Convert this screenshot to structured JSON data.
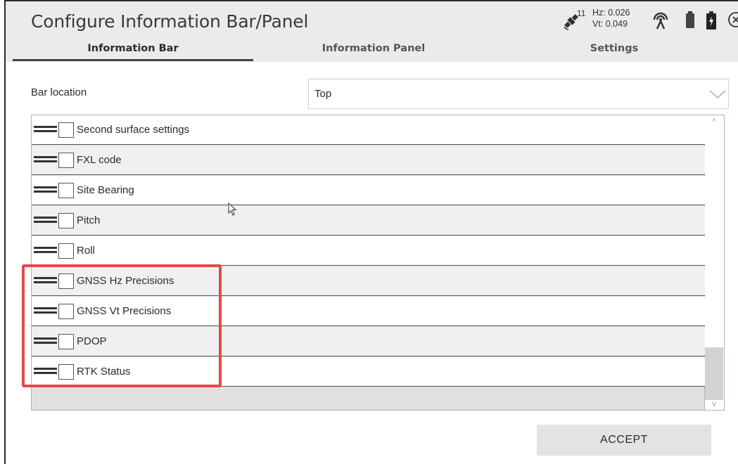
{
  "header": {
    "title": "Configure Information Bar/Panel",
    "tabs": [
      {
        "label": "Information Bar",
        "active": true
      },
      {
        "label": "Information Panel",
        "active": false
      },
      {
        "label": "Settings",
        "active": false
      }
    ]
  },
  "status": {
    "satellite_icon": "satellite-icon",
    "satellite_count": "11",
    "hz": "Hz: 0.026",
    "vt": "Vt: 0.049",
    "antenna_icon": "antenna-icon",
    "battery_icon": "battery-icon",
    "close_icon": "close-icon"
  },
  "form": {
    "bar_location_label": "Bar location",
    "bar_location_value": "Top"
  },
  "list": {
    "items": [
      {
        "label": "Second surface settings",
        "checked": false
      },
      {
        "label": "FXL code",
        "checked": false
      },
      {
        "label": "Site Bearing",
        "checked": false
      },
      {
        "label": "Pitch",
        "checked": false
      },
      {
        "label": "Roll",
        "checked": false
      },
      {
        "label": "GNSS Hz Precisions",
        "checked": false
      },
      {
        "label": "GNSS Vt Precisions",
        "checked": false
      },
      {
        "label": "PDOP",
        "checked": false
      },
      {
        "label": "RTK Status",
        "checked": false
      }
    ]
  },
  "footer": {
    "accept_label": "ACCEPT"
  },
  "colors": {
    "highlight": "#e5484d",
    "header_bg": "#ebebeb",
    "button_bg": "#e3e3e3"
  }
}
